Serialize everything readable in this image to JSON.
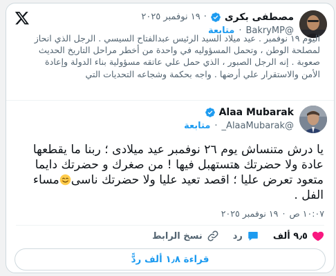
{
  "quoted_tweet": {
    "author_name": "مصطفى بكرى",
    "handle": "@BakryMP",
    "time": "١٩ نوفمبر ٢٠٢٥",
    "follow_label": "متابعة",
    "text": "اليوم ١٩ نوفمبر . عيد ميلاد السيد الرئيس عبدالفتاح السيسي . الرجل الذي انحاز لمصلحة الوطن ، وتحمل المسؤوليه في واحدة من أخطر مراحل التاريخ الحديث صعوبة . إنه الرجل الصبور ، الذي حمل علي عاتقه مسؤولية بناء الدولة وإعادة الأمن والاستقرار علي أرضها . واجه بحكمة وشجاعه التحديات التي"
  },
  "main_tweet": {
    "author_name": "Alaa Mubarak",
    "handle": "@AlaaMubarak_",
    "follow_label": "متابعة",
    "text": "يا درش متنساش يوم ٢٦ نوفمبر  عيد ميلادى ؛ ربنا ما يقطعها عادة ولا حضرتك هتستهبل فيها ! من صغرك و حضرتك دايما متعود تعرض عليا ؛ اقصد تعيد عليا ولا حضرتك ناسى",
    "text_tail": "مساء الفل .",
    "time": "١٠:٠٧ ص",
    "date": "١٩ نوفمبر ٢٠٢٥"
  },
  "actions": {
    "likes": "٩٫٥ ألف",
    "reply_label": "رد",
    "copy_link_label": "نسخ الرابط"
  },
  "read_replies_label": "قراءة ١٫٨ ألف ردًّ",
  "colors": {
    "accent": "#1d9bf0",
    "like": "#f91880",
    "muted": "#536471"
  },
  "icons": [
    "x-logo-icon",
    "verified-icon",
    "heart-icon",
    "reply-icon",
    "link-icon",
    "smiley-icon"
  ]
}
